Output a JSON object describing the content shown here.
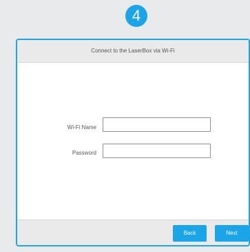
{
  "step": {
    "number": "4"
  },
  "dialog": {
    "title": "Connect to the LaserBox via Wi-Fi",
    "fields": {
      "wifi_name": {
        "label": "Wi-Fi Name",
        "value": "",
        "placeholder": ""
      },
      "password": {
        "label": "Password",
        "value": "",
        "placeholder": ""
      }
    },
    "buttons": {
      "back": "Back",
      "next": "Next"
    }
  },
  "colors": {
    "accent": "#1ba4e7",
    "background": "#e9eaec",
    "panel": "#eaeaea"
  }
}
